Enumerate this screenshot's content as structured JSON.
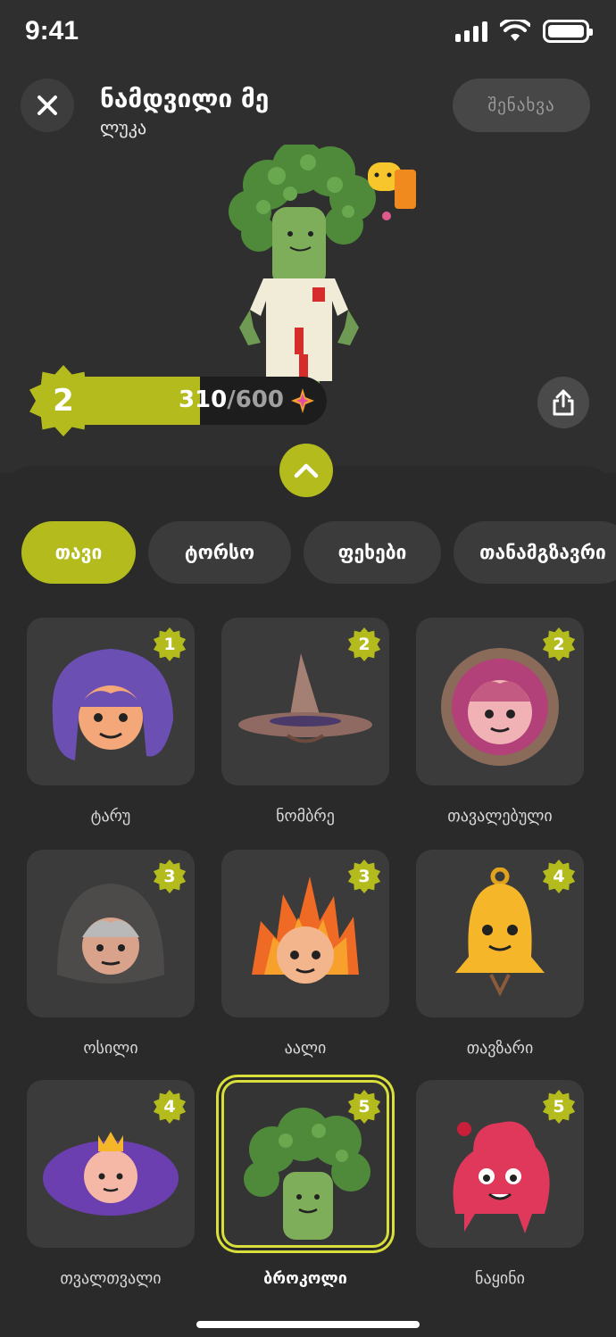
{
  "status_bar": {
    "time": "9:41"
  },
  "header": {
    "title": "ნამდვილი მე",
    "subtitle": "ლუკა",
    "save_label": "შენახვა"
  },
  "level": {
    "number": "2",
    "xp_current": "310",
    "xp_separator": "/",
    "xp_max": "600",
    "progress_fraction": 0.52
  },
  "tabs": [
    {
      "label": "თავი",
      "active": true
    },
    {
      "label": "ტორსო",
      "active": false
    },
    {
      "label": "ფეხები",
      "active": false
    },
    {
      "label": "თანამგზავრი",
      "active": false
    }
  ],
  "items": [
    {
      "label": "ტარუ",
      "level": "1",
      "icon": "purple-hair-head",
      "selected": false
    },
    {
      "label": "ნომბრე",
      "level": "2",
      "icon": "wizard-hat",
      "selected": false
    },
    {
      "label": "თავალებული",
      "level": "2",
      "icon": "astronaut-helmet",
      "selected": false
    },
    {
      "label": "ოსილი",
      "level": "3",
      "icon": "hooded-head",
      "selected": false
    },
    {
      "label": "აალი",
      "level": "3",
      "icon": "fire-head",
      "selected": false
    },
    {
      "label": "თავზარი",
      "level": "4",
      "icon": "bell-head",
      "selected": false
    },
    {
      "label": "თვალთვალი",
      "level": "4",
      "icon": "purple-eye-head",
      "selected": false
    },
    {
      "label": "ბროკოლი",
      "level": "5",
      "icon": "broccoli-head",
      "selected": true
    },
    {
      "label": "ნაყინი",
      "level": "5",
      "icon": "ice-cream-head",
      "selected": false
    }
  ],
  "colors": {
    "accent": "#b4bb1d",
    "background": "#2a2a2a",
    "card": "#3b3b3b",
    "selected_border": "#d8de3a"
  }
}
